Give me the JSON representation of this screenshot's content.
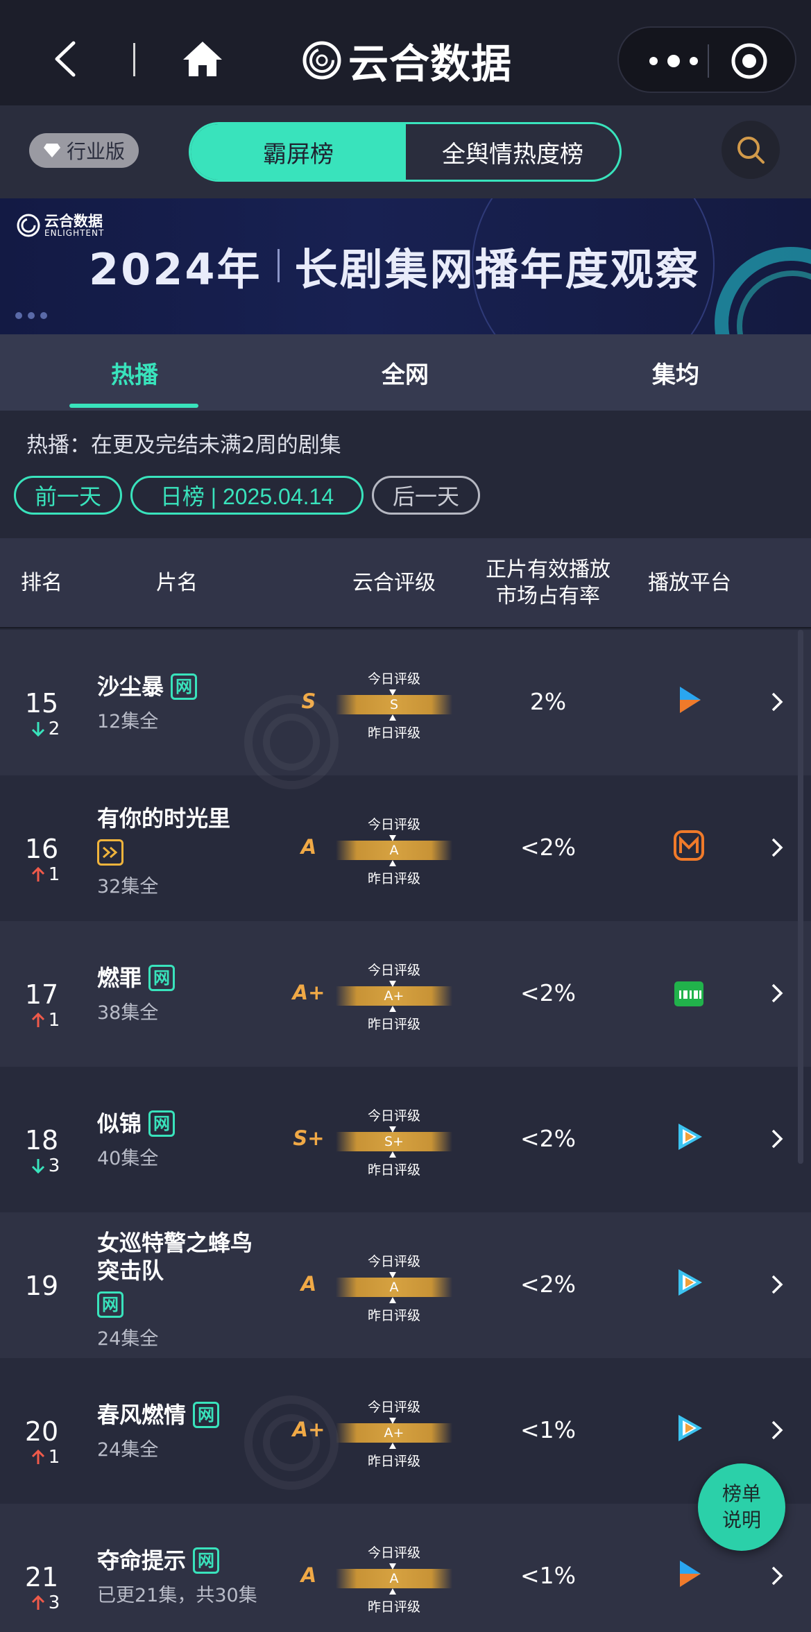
{
  "app": {
    "brand_name": "云合数据"
  },
  "toolbar": {
    "edition_label": "行业版",
    "segments": [
      "霸屏榜",
      "全舆情热度榜"
    ]
  },
  "banner": {
    "logo_name": "云合数据",
    "logo_sub": "ENLIGHTENT",
    "title_year": "2024年",
    "title_text": "长剧集网播年度观察"
  },
  "tabs": [
    "热播",
    "全网",
    "集均"
  ],
  "description": "热播：在更及完结未满2周的剧集",
  "date_nav": {
    "prev_label": "前一天",
    "current_label": "日榜 | 2025.04.14",
    "next_label": "后一天"
  },
  "table": {
    "headers": {
      "rank": "排名",
      "title": "片名",
      "rating": "云合评级",
      "share_line1": "正片有效播放",
      "share_line2": "市场占有率",
      "platform": "播放平台"
    },
    "rating_labels": {
      "today": "今日评级",
      "yesterday": "昨日评级"
    },
    "rows": [
      {
        "rank": "15",
        "trend": "down",
        "change": "2",
        "title": "沙尘暴",
        "badge": "网",
        "episodes": "12集全",
        "grade": "S",
        "grade_today": "S",
        "share": "2%",
        "platform": "tencent-video-icon"
      },
      {
        "rank": "16",
        "trend": "up",
        "change": "1",
        "title": "有你的时光里",
        "badge": "ff",
        "episodes": "32集全",
        "grade": "A",
        "grade_today": "A",
        "share": "<2%",
        "platform": "mango-tv-icon"
      },
      {
        "rank": "17",
        "trend": "up",
        "change": "1",
        "title": "燃罪",
        "badge": "网",
        "episodes": "38集全",
        "grade": "A+",
        "grade_today": "A+",
        "share": "<2%",
        "platform": "iqiyi-icon"
      },
      {
        "rank": "18",
        "trend": "down",
        "change": "3",
        "title": "似锦",
        "badge": "网",
        "episodes": "40集全",
        "grade": "S+",
        "grade_today": "S+",
        "share": "<2%",
        "platform": "tencent-video-icon"
      },
      {
        "rank": "19",
        "trend": "",
        "change": "",
        "title": "女巡特警之蜂鸟突击队",
        "badge": "网",
        "episodes": "24集全",
        "grade": "A",
        "grade_today": "A",
        "share": "<2%",
        "platform": "tencent-video-icon"
      },
      {
        "rank": "20",
        "trend": "up",
        "change": "1",
        "title": "春风燃情",
        "badge": "网",
        "episodes": "24集全",
        "grade": "A+",
        "grade_today": "A+",
        "share": "<1%",
        "platform": "tencent-video-icon"
      },
      {
        "rank": "21",
        "trend": "up",
        "change": "3",
        "title": "夺命提示",
        "badge": "网",
        "episodes": "已更21集，共30集",
        "grade": "A",
        "grade_today": "A",
        "share": "<1%",
        "platform": "tencent-video-icon"
      }
    ]
  },
  "fab": {
    "line1": "榜单",
    "line2": "说明"
  },
  "colors": {
    "accent": "#39e3bc",
    "grade": "#f0a946",
    "up": "#f05a4a",
    "down": "#39e3bc",
    "background": "#252838"
  }
}
